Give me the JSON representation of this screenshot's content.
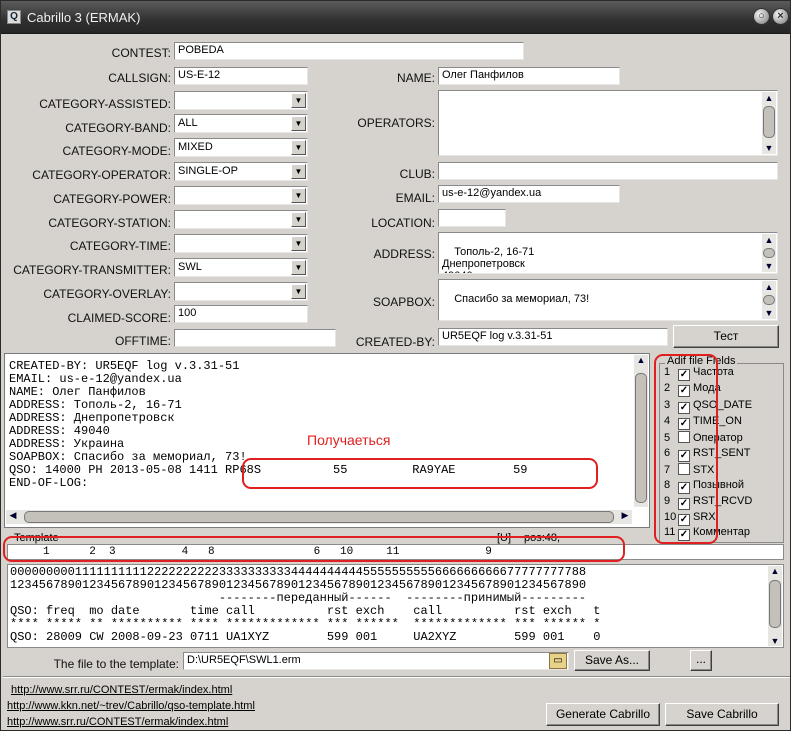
{
  "window": {
    "title": "Cabrillo 3 (ERMAK)",
    "icon": "app-icon",
    "icon_glyph": "Q"
  },
  "left_fields": [
    {
      "label": "CONTEST:",
      "value": "POBEDA"
    },
    {
      "label": "CALLSIGN:",
      "value": "US-E-12"
    },
    {
      "label": "CATEGORY-ASSISTED:",
      "value": ""
    },
    {
      "label": "CATEGORY-BAND:",
      "value": "ALL"
    },
    {
      "label": "CATEGORY-MODE:",
      "value": "MIXED"
    },
    {
      "label": "CATEGORY-OPERATOR:",
      "value": "SINGLE-OP"
    },
    {
      "label": "CATEGORY-POWER:",
      "value": ""
    },
    {
      "label": "CATEGORY-STATION:",
      "value": ""
    },
    {
      "label": "CATEGORY-TIME:",
      "value": ""
    },
    {
      "label": "CATEGORY-TRANSMITTER:",
      "value": "SWL"
    },
    {
      "label": "CATEGORY-OVERLAY:",
      "value": ""
    },
    {
      "label": "CLAIMED-SCORE:",
      "value": "100"
    },
    {
      "label": "OFFTIME:",
      "value": ""
    }
  ],
  "right_fields": {
    "name": {
      "label": "NAME:",
      "value": "Олег Панфилов"
    },
    "operators": {
      "label": "OPERATORS:",
      "value": ""
    },
    "club": {
      "label": "CLUB:",
      "value": ""
    },
    "email": {
      "label": "EMAIL:",
      "value": "us-e-12@yandex.ua"
    },
    "location": {
      "label": "LOCATION:",
      "value": ""
    },
    "address": {
      "label": "ADDRESS:",
      "value": "Тополь-2, 16-71\nДнепропетровск\n49040"
    },
    "soapbox": {
      "label": "SOAPBOX:",
      "value": "Спасибо за мемориал, 73!"
    },
    "created_by": {
      "label": "CREATED-BY:",
      "value": "UR5EQF log v.3.31-51"
    }
  },
  "test_button": "Тест",
  "output_lines": [
    "CREATED-BY: UR5EQF log v.3.31-51",
    "EMAIL: us-e-12@yandex.ua",
    "NAME: Олег Панфилов",
    "ADDRESS: Тополь-2, 16-71",
    "ADDRESS: Днепропетровск",
    "ADDRESS: 49040",
    "ADDRESS: Украина",
    "SOAPBOX: Спасибо за мемориал, 73!",
    "QSO: 14000 PH 2013-05-08 1411 RP68S          55         RA9YAE        59",
    "END-OF-LOG:"
  ],
  "annotation": "Получаеться",
  "adif": {
    "title": "Adif file Fields",
    "fields": [
      {
        "num": "1",
        "label": "Частота",
        "checked": true
      },
      {
        "num": "2",
        "label": "Мода",
        "checked": true
      },
      {
        "num": "3",
        "label": "QSO_DATE",
        "checked": true
      },
      {
        "num": "4",
        "label": "TIME_ON",
        "checked": true
      },
      {
        "num": "5",
        "label": "Оператор",
        "checked": false
      },
      {
        "num": "6",
        "label": "RST_SENT",
        "checked": true
      },
      {
        "num": "7",
        "label": "STX",
        "checked": false
      },
      {
        "num": "8",
        "label": "Позывной",
        "checked": true
      },
      {
        "num": "9",
        "label": "RST_RCVD",
        "checked": true
      },
      {
        "num": "10",
        "label": "SRX",
        "checked": true
      },
      {
        "num": "11",
        "label": "Комментар",
        "checked": true
      }
    ]
  },
  "template": {
    "label": "Template",
    "u_label": "[U]",
    "pos_label": "pos:48,",
    "positions_line": "     1      2  3          4   8               6   10     11             9"
  },
  "ruler_lines": [
    "00000000011111111112222222222333333333344444444445555555555666666666677777777788",
    "12345678901234567890123456789012345678901234567890123456789012345678901234567890",
    "                             --------переданный------  --------принимый---------",
    "QSO: freq  mo date       time call          rst exch    call          rst exch   t",
    "**** ***** ** ********** **** ************* *** ******  ************* *** ****** *",
    "QSO: 28009 CW 2008-09-23 0711 UA1XYZ        599 001     UA2XYZ        599 001    0"
  ],
  "template_file": {
    "label": "The file to the template:",
    "value": "D:\\UR5EQF\\SWL1.erm"
  },
  "buttons": {
    "save_as": "Save As...",
    "ellipsis": "...",
    "generate": "Generate Cabrillo",
    "save": "Save Cabrillo"
  },
  "links": [
    "http://www.srr.ru/CONTEST/ermak/index.html",
    "http://www.kkn.net/~trev/Cabrillo/qso-template.html",
    "http://www.srr.ru/CONTEST/ermak/index.html"
  ]
}
